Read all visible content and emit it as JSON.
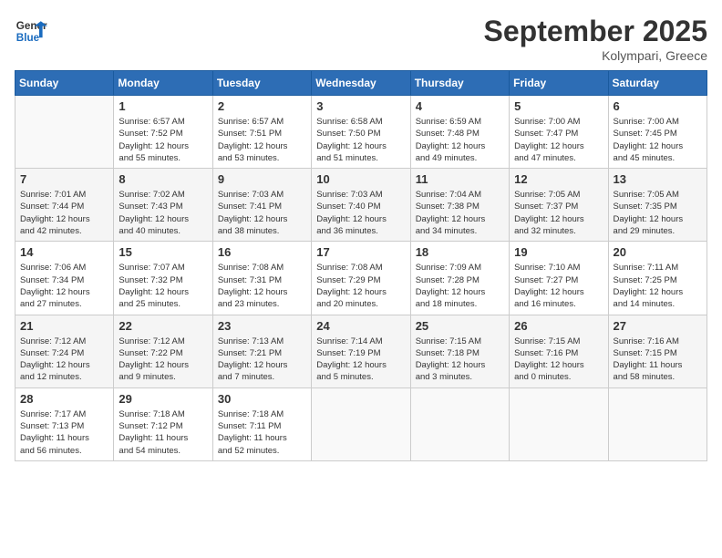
{
  "logo": {
    "line1": "General",
    "line2": "Blue"
  },
  "title": "September 2025",
  "location": "Kolympari, Greece",
  "days_of_week": [
    "Sunday",
    "Monday",
    "Tuesday",
    "Wednesday",
    "Thursday",
    "Friday",
    "Saturday"
  ],
  "weeks": [
    [
      {
        "num": "",
        "info": ""
      },
      {
        "num": "1",
        "info": "Sunrise: 6:57 AM\nSunset: 7:52 PM\nDaylight: 12 hours\nand 55 minutes."
      },
      {
        "num": "2",
        "info": "Sunrise: 6:57 AM\nSunset: 7:51 PM\nDaylight: 12 hours\nand 53 minutes."
      },
      {
        "num": "3",
        "info": "Sunrise: 6:58 AM\nSunset: 7:50 PM\nDaylight: 12 hours\nand 51 minutes."
      },
      {
        "num": "4",
        "info": "Sunrise: 6:59 AM\nSunset: 7:48 PM\nDaylight: 12 hours\nand 49 minutes."
      },
      {
        "num": "5",
        "info": "Sunrise: 7:00 AM\nSunset: 7:47 PM\nDaylight: 12 hours\nand 47 minutes."
      },
      {
        "num": "6",
        "info": "Sunrise: 7:00 AM\nSunset: 7:45 PM\nDaylight: 12 hours\nand 45 minutes."
      }
    ],
    [
      {
        "num": "7",
        "info": "Sunrise: 7:01 AM\nSunset: 7:44 PM\nDaylight: 12 hours\nand 42 minutes."
      },
      {
        "num": "8",
        "info": "Sunrise: 7:02 AM\nSunset: 7:43 PM\nDaylight: 12 hours\nand 40 minutes."
      },
      {
        "num": "9",
        "info": "Sunrise: 7:03 AM\nSunset: 7:41 PM\nDaylight: 12 hours\nand 38 minutes."
      },
      {
        "num": "10",
        "info": "Sunrise: 7:03 AM\nSunset: 7:40 PM\nDaylight: 12 hours\nand 36 minutes."
      },
      {
        "num": "11",
        "info": "Sunrise: 7:04 AM\nSunset: 7:38 PM\nDaylight: 12 hours\nand 34 minutes."
      },
      {
        "num": "12",
        "info": "Sunrise: 7:05 AM\nSunset: 7:37 PM\nDaylight: 12 hours\nand 32 minutes."
      },
      {
        "num": "13",
        "info": "Sunrise: 7:05 AM\nSunset: 7:35 PM\nDaylight: 12 hours\nand 29 minutes."
      }
    ],
    [
      {
        "num": "14",
        "info": "Sunrise: 7:06 AM\nSunset: 7:34 PM\nDaylight: 12 hours\nand 27 minutes."
      },
      {
        "num": "15",
        "info": "Sunrise: 7:07 AM\nSunset: 7:32 PM\nDaylight: 12 hours\nand 25 minutes."
      },
      {
        "num": "16",
        "info": "Sunrise: 7:08 AM\nSunset: 7:31 PM\nDaylight: 12 hours\nand 23 minutes."
      },
      {
        "num": "17",
        "info": "Sunrise: 7:08 AM\nSunset: 7:29 PM\nDaylight: 12 hours\nand 20 minutes."
      },
      {
        "num": "18",
        "info": "Sunrise: 7:09 AM\nSunset: 7:28 PM\nDaylight: 12 hours\nand 18 minutes."
      },
      {
        "num": "19",
        "info": "Sunrise: 7:10 AM\nSunset: 7:27 PM\nDaylight: 12 hours\nand 16 minutes."
      },
      {
        "num": "20",
        "info": "Sunrise: 7:11 AM\nSunset: 7:25 PM\nDaylight: 12 hours\nand 14 minutes."
      }
    ],
    [
      {
        "num": "21",
        "info": "Sunrise: 7:12 AM\nSunset: 7:24 PM\nDaylight: 12 hours\nand 12 minutes."
      },
      {
        "num": "22",
        "info": "Sunrise: 7:12 AM\nSunset: 7:22 PM\nDaylight: 12 hours\nand 9 minutes."
      },
      {
        "num": "23",
        "info": "Sunrise: 7:13 AM\nSunset: 7:21 PM\nDaylight: 12 hours\nand 7 minutes."
      },
      {
        "num": "24",
        "info": "Sunrise: 7:14 AM\nSunset: 7:19 PM\nDaylight: 12 hours\nand 5 minutes."
      },
      {
        "num": "25",
        "info": "Sunrise: 7:15 AM\nSunset: 7:18 PM\nDaylight: 12 hours\nand 3 minutes."
      },
      {
        "num": "26",
        "info": "Sunrise: 7:15 AM\nSunset: 7:16 PM\nDaylight: 12 hours\nand 0 minutes."
      },
      {
        "num": "27",
        "info": "Sunrise: 7:16 AM\nSunset: 7:15 PM\nDaylight: 11 hours\nand 58 minutes."
      }
    ],
    [
      {
        "num": "28",
        "info": "Sunrise: 7:17 AM\nSunset: 7:13 PM\nDaylight: 11 hours\nand 56 minutes."
      },
      {
        "num": "29",
        "info": "Sunrise: 7:18 AM\nSunset: 7:12 PM\nDaylight: 11 hours\nand 54 minutes."
      },
      {
        "num": "30",
        "info": "Sunrise: 7:18 AM\nSunset: 7:11 PM\nDaylight: 11 hours\nand 52 minutes."
      },
      {
        "num": "",
        "info": ""
      },
      {
        "num": "",
        "info": ""
      },
      {
        "num": "",
        "info": ""
      },
      {
        "num": "",
        "info": ""
      }
    ]
  ]
}
